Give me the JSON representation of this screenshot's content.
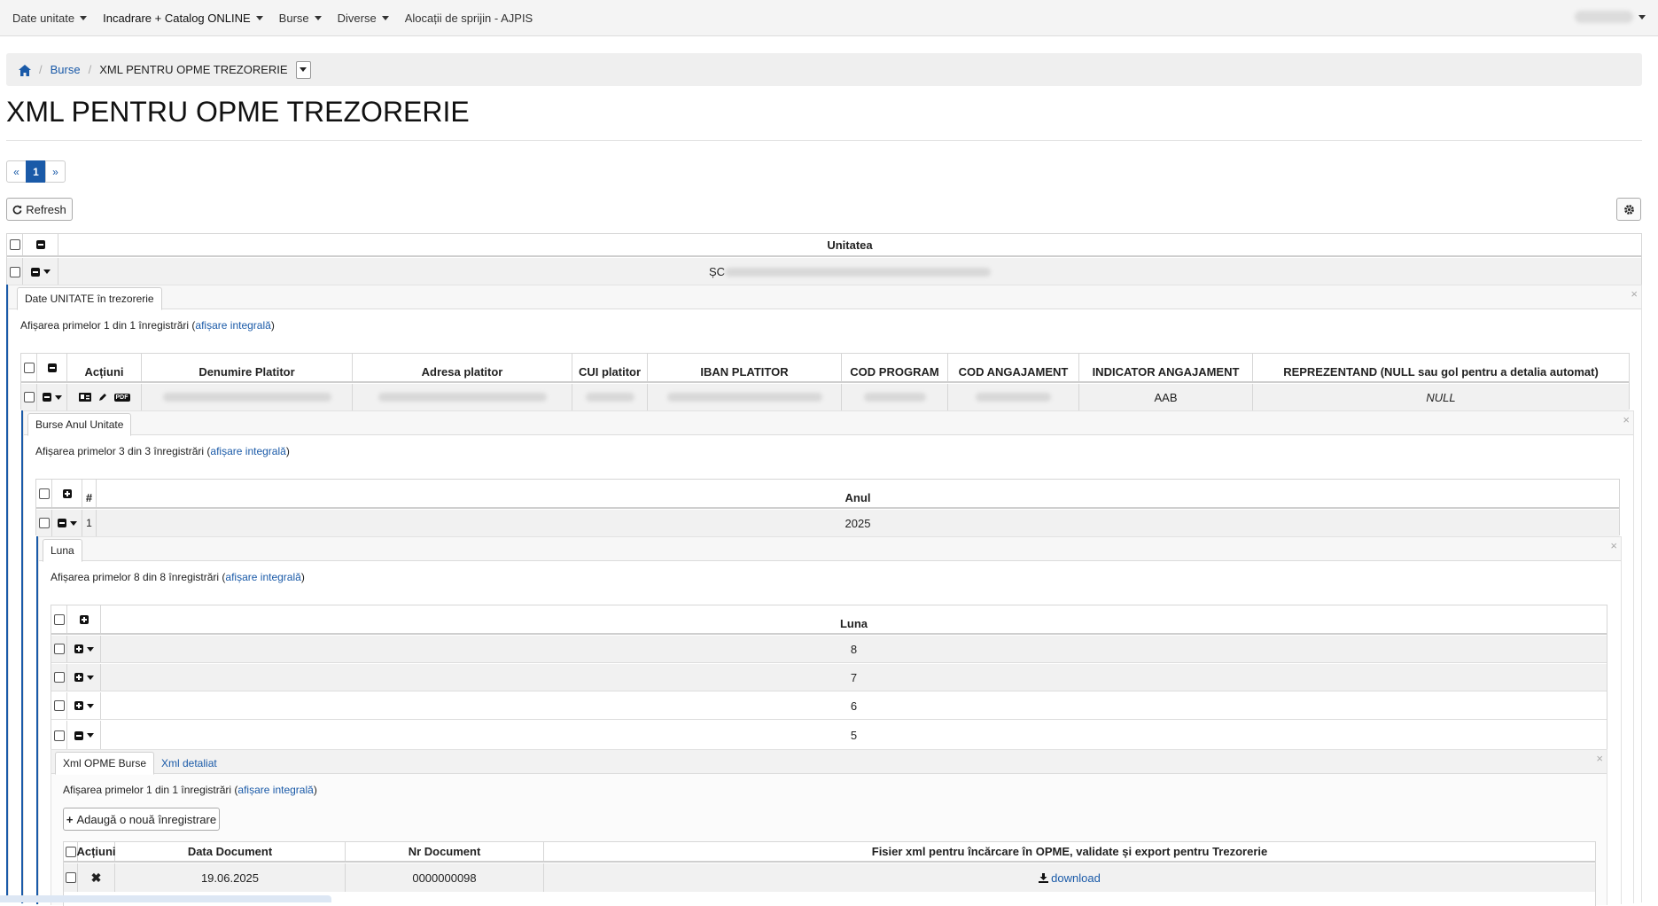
{
  "navbar": {
    "items": [
      {
        "label": "Date unitate",
        "dropdown": true
      },
      {
        "label": "Incadrare + Catalog ONLINE",
        "dropdown": true
      },
      {
        "label": "Burse",
        "dropdown": true
      },
      {
        "label": "Diverse",
        "dropdown": true
      },
      {
        "label": "Alocații de sprijin - AJPIS",
        "dropdown": false
      }
    ]
  },
  "breadcrumb": {
    "items": [
      "Burse",
      "XML PENTRU OPME TREZORERIE"
    ]
  },
  "page": {
    "title": "XML PENTRU OPME TREZORERIE"
  },
  "pager": {
    "prev": "«",
    "current": "1",
    "next": "»"
  },
  "toolbar": {
    "refresh_label": "Refresh"
  },
  "main_table": {
    "header": "Unitatea",
    "row_value_visible": "ȘC"
  },
  "treasury_panel": {
    "tab": "Date UNITATE în trezorerie",
    "info_prefix": "Afișarea primelor 1 din 1 înregistrări (",
    "info_link": "afișare integrală",
    "info_suffix": ")",
    "columns": [
      "Acțiuni",
      "Denumire Platitor",
      "Adresa platitor",
      "CUI platitor",
      "IBAN PLATITOR",
      "COD PROGRAM",
      "COD ANGAJAMENT",
      "INDICATOR ANGAJAMENT",
      "REPREZENTAND (NULL sau gol pentru a detalia automat)"
    ],
    "row": {
      "indicator": "AAB",
      "reprezentand": "NULL",
      "pdf": "PDF"
    }
  },
  "year_panel": {
    "tab": "Burse Anul Unitate",
    "info_prefix": "Afișarea primelor 3 din 3 înregistrări (",
    "info_link": "afișare integrală",
    "info_suffix": ")",
    "columns": [
      "#",
      "Anul"
    ],
    "row": {
      "index": "1",
      "year": "2025"
    }
  },
  "month_panel": {
    "tab": "Luna",
    "info_prefix": "Afișarea primelor 8 din 8 înregistrări (",
    "info_link": "afișare integrală",
    "info_suffix": ")",
    "header": "Luna",
    "rows": [
      "8",
      "7",
      "6",
      "5"
    ]
  },
  "xml_panel": {
    "tabs": [
      "Xml OPME Burse",
      "Xml detaliat"
    ],
    "info_prefix": "Afișarea primelor 1 din 1 înregistrări (",
    "info_link": "afișare integrală",
    "info_suffix": ")",
    "add_label": "Adaugă o nouă înregistrare",
    "columns": [
      "Acțiuni",
      "Data Document",
      "Nr Document",
      "Fisier xml pentru încărcare în OPME, validate și export pentru Trezorerie"
    ],
    "row": {
      "date": "19.06.2025",
      "number": "0000000098",
      "download": "download"
    }
  },
  "colors": {
    "accent": "#1a5aa8",
    "navbar_bg": "#f4f4f4",
    "row_shade": "#f1f1f1"
  }
}
